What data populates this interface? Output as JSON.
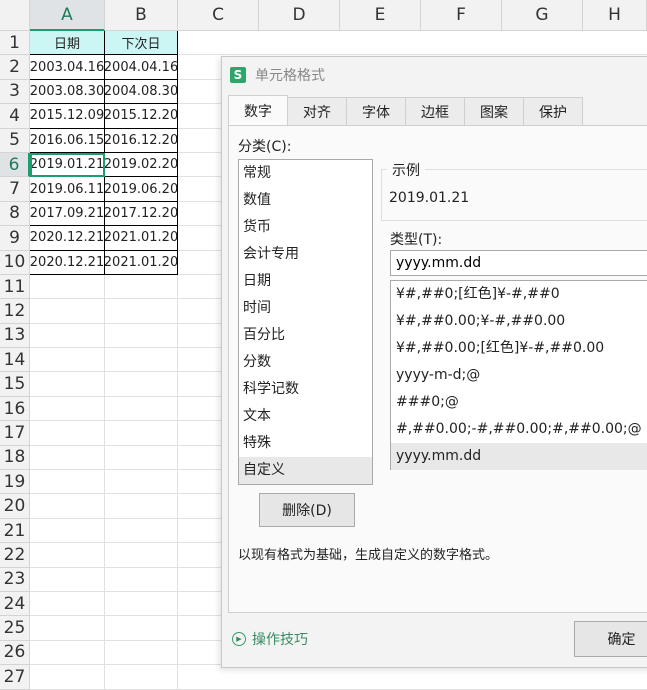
{
  "sheet": {
    "columns": [
      "A",
      "B",
      "C",
      "D",
      "E",
      "F",
      "G",
      "H"
    ],
    "rows": [
      "1",
      "2",
      "3",
      "4",
      "5",
      "6",
      "7",
      "8",
      "9",
      "10",
      "11",
      "12",
      "13",
      "14",
      "15",
      "16",
      "17",
      "18",
      "19",
      "20",
      "21",
      "22",
      "23",
      "24",
      "25",
      "26",
      "27"
    ],
    "header": [
      "日期",
      "下次日"
    ],
    "data": [
      [
        "2003.04.16",
        "2004.04.16"
      ],
      [
        "2003.08.30",
        "2004.08.30"
      ],
      [
        "2015.12.09",
        "2015.12.20"
      ],
      [
        "2016.06.15",
        "2016.12.20"
      ],
      [
        "2019.01.21",
        "2019.02.20"
      ],
      [
        "2019.06.11",
        "2019.06.20"
      ],
      [
        "2017.09.21",
        "2017.12.20"
      ],
      [
        "2020.12.21",
        "2021.01.20"
      ],
      [
        "2020.12.21",
        "2021.01.20"
      ]
    ]
  },
  "dialog": {
    "app_icon": "S",
    "title": "单元格格式",
    "tabs": [
      "数字",
      "对齐",
      "字体",
      "边框",
      "图案",
      "保护"
    ],
    "category_label": "分类(C):",
    "categories": [
      "常规",
      "数值",
      "货币",
      "会计专用",
      "日期",
      "时间",
      "百分比",
      "分数",
      "科学记数",
      "文本",
      "特殊",
      "自定义"
    ],
    "sample_label": "示例",
    "sample_value": "2019.01.21",
    "type_label": "类型(T):",
    "type_value": "yyyy.mm.dd",
    "formats": [
      "¥#,##0;[红色]¥-#,##0",
      "¥#,##0.00;¥-#,##0.00",
      "¥#,##0.00;[红色]¥-#,##0.00",
      "yyyy-m-d;@",
      "###0;@",
      "#,##0.00;-#,##0.00;#,##0.00;@",
      "yyyy.mm.dd"
    ],
    "delete_label": "删除(D)",
    "description": "以现有格式为基础，生成自定义的数字格式。",
    "tips_label": "操作技巧",
    "ok_label": "确定"
  }
}
